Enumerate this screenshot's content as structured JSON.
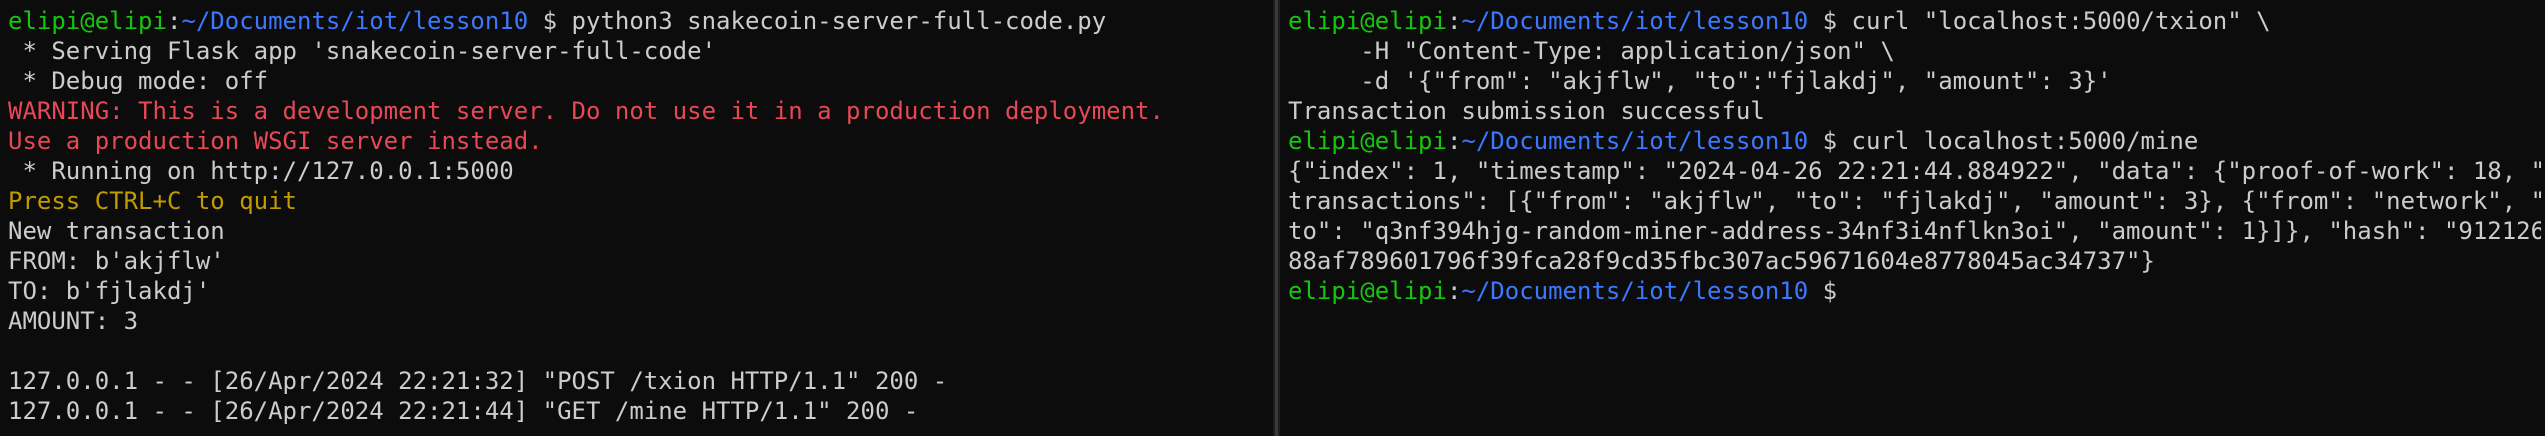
{
  "left": {
    "prompt": {
      "user": "elipi@elipi",
      "sep": ":",
      "path": "~/Documents/iot/lesson10",
      "symbol": " $ ",
      "command": "python3 snakecoin-server-full-code.py"
    },
    "lines": [
      " * Serving Flask app 'snakecoin-server-full-code'",
      " * Debug mode: off",
      "WARNING: This is a development server. Do not use it in a production deployment.",
      "Use a production WSGI server instead.",
      " * Running on http://127.0.0.1:5000",
      "Press CTRL+C to quit",
      "New transaction",
      "FROM: b'akjflw'",
      "TO: b'fjlakdj'",
      "AMOUNT: 3",
      "",
      "127.0.0.1 - - [26/Apr/2024 22:21:32] \"POST /txion HTTP/1.1\" 200 -",
      "127.0.0.1 - - [26/Apr/2024 22:21:44] \"GET /mine HTTP/1.1\" 200 -"
    ]
  },
  "right": {
    "prompt1": {
      "user": "elipi@elipi",
      "sep": ":",
      "path": "~/Documents/iot/lesson10",
      "symbol": " $ ",
      "command": "curl \"localhost:5000/txion\" \\"
    },
    "cont1": "     -H \"Content-Type: application/json\" \\",
    "cont2": "     -d '{\"from\": \"akjflw\", \"to\":\"fjlakdj\", \"amount\": 3}'",
    "result1": "Transaction submission successful",
    "prompt2": {
      "user": "elipi@elipi",
      "sep": ":",
      "path": "~/Documents/iot/lesson10",
      "symbol": " $ ",
      "command": "curl localhost:5000/mine"
    },
    "output": [
      "{\"index\": 1, \"timestamp\": \"2024-04-26 22:21:44.884922\", \"data\": {\"proof-of-work\": 18, \"",
      "transactions\": [{\"from\": \"akjflw\", \"to\": \"fjlakdj\", \"amount\": 3}, {\"from\": \"network\", \"",
      "to\": \"q3nf394hjg-random-miner-address-34nf3i4nflkn3oi\", \"amount\": 1}]}, \"hash\": \"912126",
      "88af789601796f39fca28f9cd35fbc307ac59671604e8778045ac34737\"}"
    ],
    "prompt3": {
      "user": "elipi@elipi",
      "sep": ":",
      "path": "~/Documents/iot/lesson10",
      "symbol": " $ ",
      "command": ""
    }
  },
  "colors": {
    "background": "#0c0c0c",
    "text": "#cccccc",
    "prompt_user": "#16c60c",
    "prompt_path": "#3b78ff",
    "warning": "#e74856",
    "notice": "#c19c00"
  }
}
